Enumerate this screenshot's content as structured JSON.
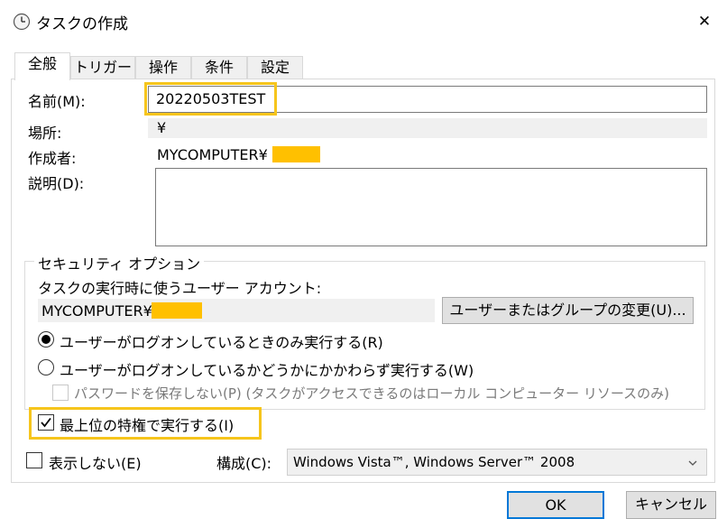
{
  "window": {
    "title": "タスクの作成",
    "close_symbol": "✕"
  },
  "tabs": [
    {
      "label": "全般",
      "active": true
    },
    {
      "label": "トリガー",
      "active": false
    },
    {
      "label": "操作",
      "active": false
    },
    {
      "label": "条件",
      "active": false
    },
    {
      "label": "設定",
      "active": false
    }
  ],
  "general": {
    "name_label": "名前(M):",
    "name_value": "20220503TEST",
    "location_label": "場所:",
    "location_value": "¥",
    "author_label": "作成者:",
    "author_value": "MYCOMPUTER¥",
    "description_label": "説明(D):",
    "description_value": ""
  },
  "security": {
    "group_title": "セキュリティ オプション",
    "account_label": "タスクの実行時に使うユーザー アカウント:",
    "account_value": "MYCOMPUTER¥",
    "change_button": "ユーザーまたはグループの変更(U)...",
    "radio_logged_on": "ユーザーがログオンしているときのみ実行する(R)",
    "radio_logged_on_selected": true,
    "radio_whether": "ユーザーがログオンしているかどうかにかかわらず実行する(W)",
    "no_password_label": "パスワードを保存しない(P) (タスクがアクセスできるのはローカル コンピューター リソースのみ)",
    "highest_privileges_label": "最上位の特権で実行する(I)",
    "highest_privileges_checked": true
  },
  "bottom": {
    "hidden_label": "表示しない(E)",
    "hidden_checked": false,
    "configure_label": "構成(C):",
    "configure_value": "Windows Vista™, Windows Server™ 2008"
  },
  "buttons": {
    "ok": "OK",
    "cancel": "キャンセル"
  },
  "colors": {
    "highlight": "#f6c51c",
    "redaction": "#ffc000",
    "accent": "#0078d7"
  }
}
